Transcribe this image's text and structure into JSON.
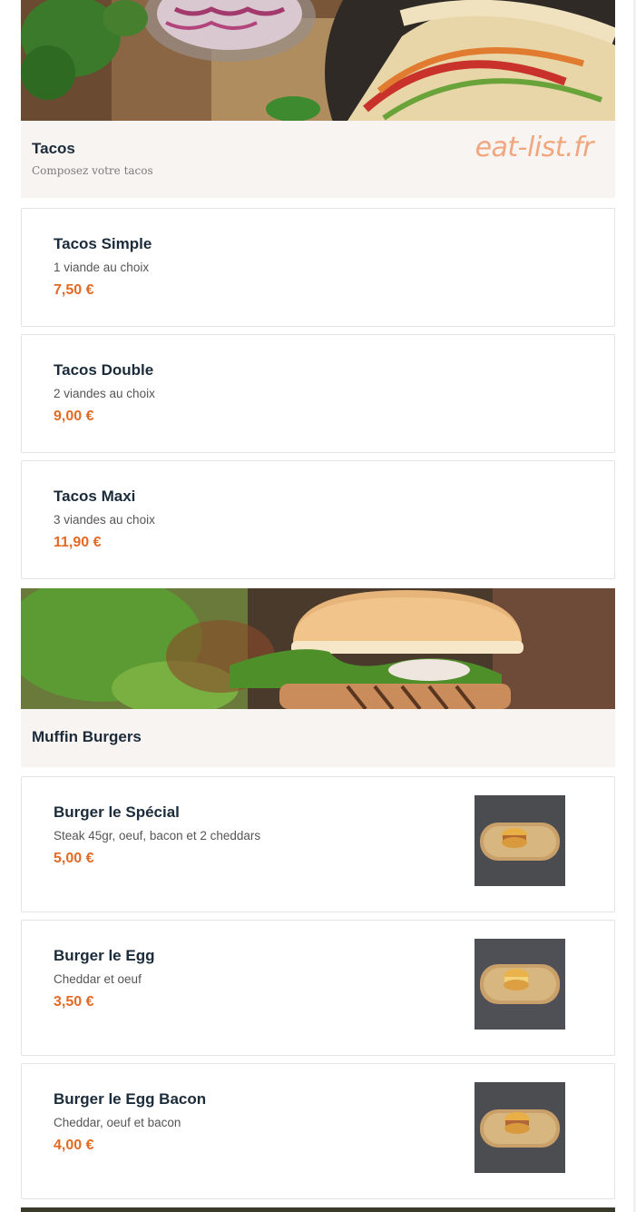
{
  "brand": "eat-list.fr",
  "categories": [
    {
      "title": "Tacos",
      "subtitle": "Composez votre tacos",
      "items": [
        {
          "name": "Tacos Simple",
          "desc": "1 viande au choix",
          "price": "7,50 €"
        },
        {
          "name": "Tacos Double",
          "desc": "2 viandes au choix",
          "price": "9,00 €"
        },
        {
          "name": "Tacos Maxi",
          "desc": "3 viandes au choix",
          "price": "11,90 €"
        }
      ]
    },
    {
      "title": "Muffin Burgers",
      "items": [
        {
          "name": "Burger le Spécial",
          "desc": "Steak 45gr, oeuf, bacon et 2 cheddars",
          "price": "5,00 €"
        },
        {
          "name": "Burger le Egg",
          "desc": "Cheddar et oeuf",
          "price": "3,50 €"
        },
        {
          "name": "Burger le Egg Bacon",
          "desc": "Cheddar, oeuf et bacon",
          "price": "4,00 €"
        }
      ]
    }
  ],
  "icons": {
    "tacos_banner": "tacos-photo",
    "burgers_banner": "burger-photo",
    "item_thumb": "muffin-burger-photo"
  }
}
